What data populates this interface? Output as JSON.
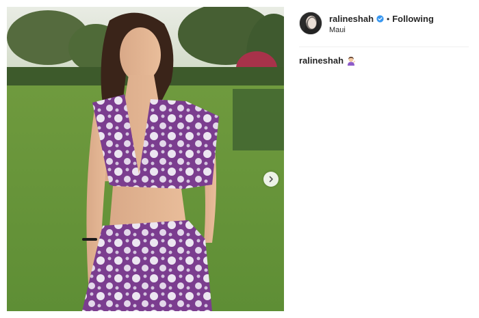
{
  "post": {
    "username": "ralineshah",
    "follow_status": "Following",
    "separator": "•",
    "location": "Maui",
    "caption_username": "ralineshah",
    "caption_emoji": "woman-tipping-hand-emoji"
  },
  "photo": {
    "description_icon": "photo",
    "next_icon": "chevron-right-icon"
  },
  "colors": {
    "verified_badge": "#3897f0",
    "divider": "#efefef",
    "text": "#262626"
  }
}
